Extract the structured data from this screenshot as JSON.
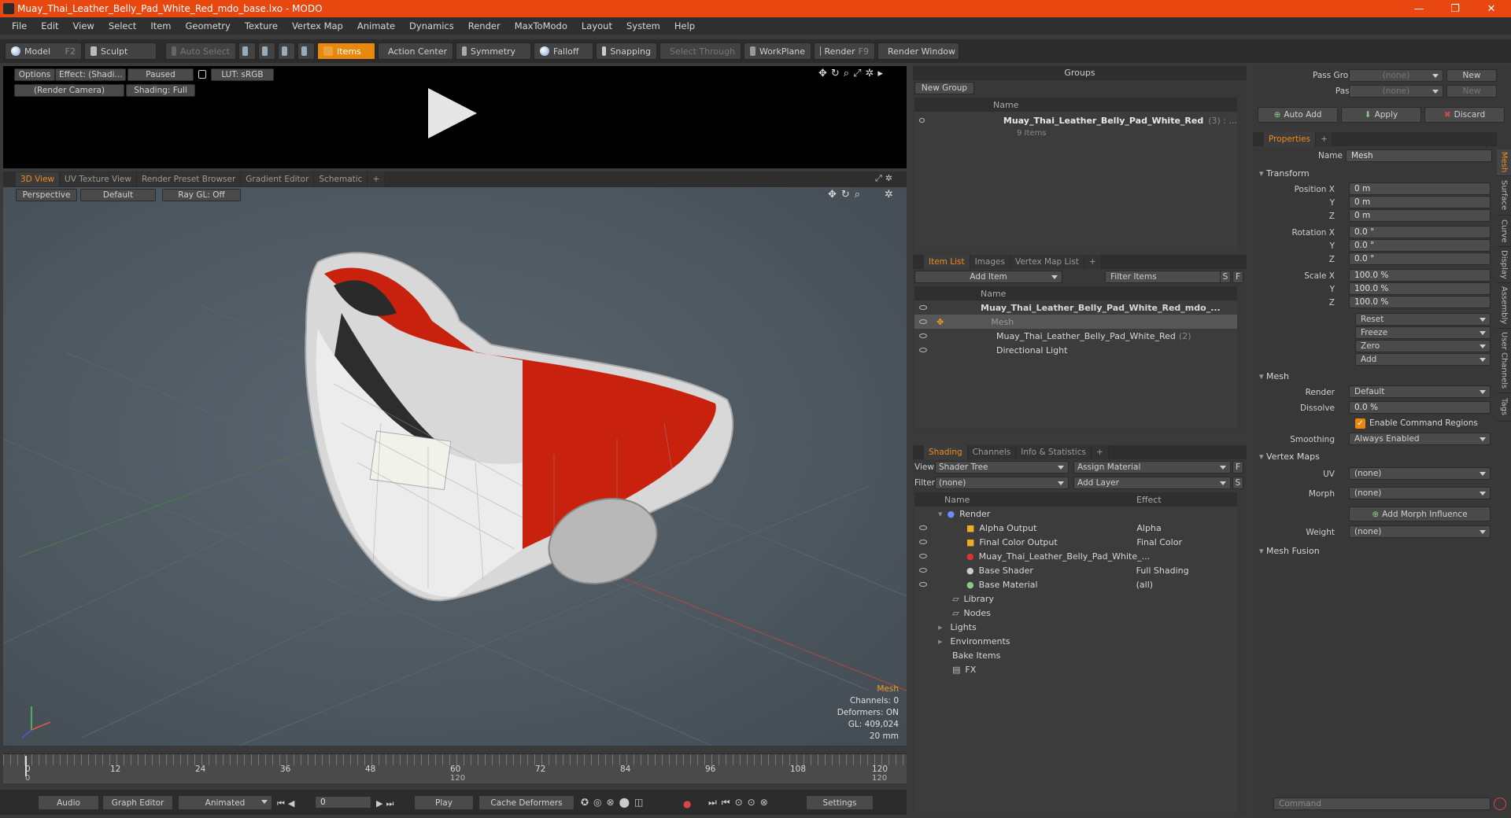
{
  "window": {
    "title": "Muay_Thai_Leather_Belly_Pad_White_Red_mdo_base.lxo - MODO",
    "minimize": "—",
    "maximize": "❐",
    "close": "✕"
  },
  "menu": [
    "File",
    "Edit",
    "View",
    "Select",
    "Item",
    "Geometry",
    "Texture",
    "Vertex Map",
    "Animate",
    "Dynamics",
    "Render",
    "MaxToModo",
    "Layout",
    "System",
    "Help"
  ],
  "toolbar": {
    "model": "Model",
    "model_key": "F2",
    "sculpt": "Sculpt",
    "auto_select": "Auto Select",
    "items": "Items",
    "action_center": "Action Center",
    "symmetry": "Symmetry",
    "falloff": "Falloff",
    "snapping": "Snapping",
    "select_through": "Select Through",
    "workplane": "WorkPlane",
    "render": "Render",
    "render_key": "F9",
    "render_window": "Render Window"
  },
  "preview": {
    "options": "Options",
    "effect": "Effect: (Shadi...",
    "paused": "Paused",
    "lut": "LUT: sRGB",
    "camera": "(Render Camera)",
    "shading": "Shading: Full"
  },
  "viewport": {
    "tabs": [
      "3D View",
      "UV Texture View",
      "Render Preset Browser",
      "Gradient Editor",
      "Schematic",
      "+"
    ],
    "perspective": "Perspective",
    "default": "Default",
    "raygl": "Ray GL: Off",
    "info_title": "Mesh",
    "channels": "Channels: 0",
    "deformers": "Deformers: ON",
    "gl": "GL: 409,024",
    "scale": "20 mm"
  },
  "timeline": {
    "ticks": [
      "0",
      "12",
      "24",
      "36",
      "48",
      "60",
      "72",
      "84",
      "96",
      "108",
      "120"
    ],
    "sub_ticks": [
      "0",
      "120",
      "120"
    ]
  },
  "bottombar": {
    "audio": "Audio",
    "graph_editor": "Graph Editor",
    "animated": "Animated",
    "frame": "0",
    "play": "Play",
    "cache": "Cache Deformers",
    "settings": "Settings"
  },
  "groups": {
    "title": "Groups",
    "new_group": "New Group",
    "col_name": "Name",
    "item_name": "Muay_Thai_Leather_Belly_Pad_White_Red",
    "item_count": "(3) : ...",
    "item_sub": "9 Items"
  },
  "itemlist": {
    "tabs": [
      "Item List",
      "Images",
      "Vertex Map List",
      "+"
    ],
    "add_item": "Add Item",
    "filter": "Filter Items",
    "s": "S",
    "f": "F",
    "col_name": "Name",
    "rows": [
      {
        "name": "Muay_Thai_Leather_Belly_Pad_White_Red_mdo_...",
        "extra": ""
      },
      {
        "name": "Mesh",
        "extra": ""
      },
      {
        "name": "Muay_Thai_Leather_Belly_Pad_White_Red",
        "extra": "(2)"
      },
      {
        "name": "Directional Light",
        "extra": ""
      }
    ]
  },
  "shading": {
    "tabs": [
      "Shading",
      "Channels",
      "Info & Statistics",
      "+"
    ],
    "view_label": "View",
    "view_value": "Shader Tree",
    "assign": "Assign Material",
    "f": "F",
    "filter_label": "Filter",
    "filter_value": "(none)",
    "add_layer": "Add Layer",
    "s": "S",
    "col_name": "Name",
    "col_effect": "Effect",
    "rows": [
      {
        "name": "Render",
        "effect": ""
      },
      {
        "name": "Alpha Output",
        "effect": "Alpha"
      },
      {
        "name": "Final Color Output",
        "effect": "Final Color"
      },
      {
        "name": "Muay_Thai_Leather_Belly_Pad_White_...",
        "effect": ""
      },
      {
        "name": "Base Shader",
        "effect": "Full Shading"
      },
      {
        "name": "Base Material",
        "effect": "(all)"
      },
      {
        "name": "Library",
        "effect": ""
      },
      {
        "name": "Nodes",
        "effect": ""
      },
      {
        "name": "Lights",
        "effect": ""
      },
      {
        "name": "Environments",
        "effect": ""
      },
      {
        "name": "Bake Items",
        "effect": ""
      },
      {
        "name": "FX",
        "effect": ""
      }
    ]
  },
  "properties": {
    "pass_groups": "Pass Groups",
    "passes": "Passes",
    "none": "(none)",
    "new": "New",
    "auto_add": "Auto Add",
    "apply": "Apply",
    "discard": "Discard",
    "tab": "Properties",
    "plus": "+",
    "name_label": "Name",
    "name_value": "Mesh",
    "transform": "Transform",
    "position_x": "Position X",
    "y": "Y",
    "z": "Z",
    "rotation_x": "Rotation X",
    "scale_x": "Scale X",
    "pos": [
      "0 m",
      "0 m",
      "0 m"
    ],
    "rot": [
      "0.0 °",
      "0.0 °",
      "0.0 °"
    ],
    "scl": [
      "100.0 %",
      "100.0 %",
      "100.0 %"
    ],
    "reset": "Reset",
    "freeze": "Freeze",
    "zero": "Zero",
    "add": "Add",
    "mesh": "Mesh",
    "render_label": "Render",
    "render_value": "Default",
    "dissolve_label": "Dissolve",
    "dissolve_value": "0.0 %",
    "enable_cmd": "Enable Command Regions",
    "smoothing_label": "Smoothing",
    "smoothing_value": "Always Enabled",
    "vertex_maps": "Vertex Maps",
    "uv_label": "UV",
    "morph_label": "Morph",
    "add_morph": "Add Morph Influence",
    "weight_label": "Weight",
    "mesh_fusion": "Mesh Fusion",
    "vtabs": [
      "Mesh",
      "Surface",
      "Curve",
      "Display",
      "Assembly",
      "User Channels",
      "Tags"
    ],
    "command": "Command"
  },
  "colors": {
    "accent": "#f08a1c",
    "title": "#e8470f",
    "red": "#c8220f"
  }
}
